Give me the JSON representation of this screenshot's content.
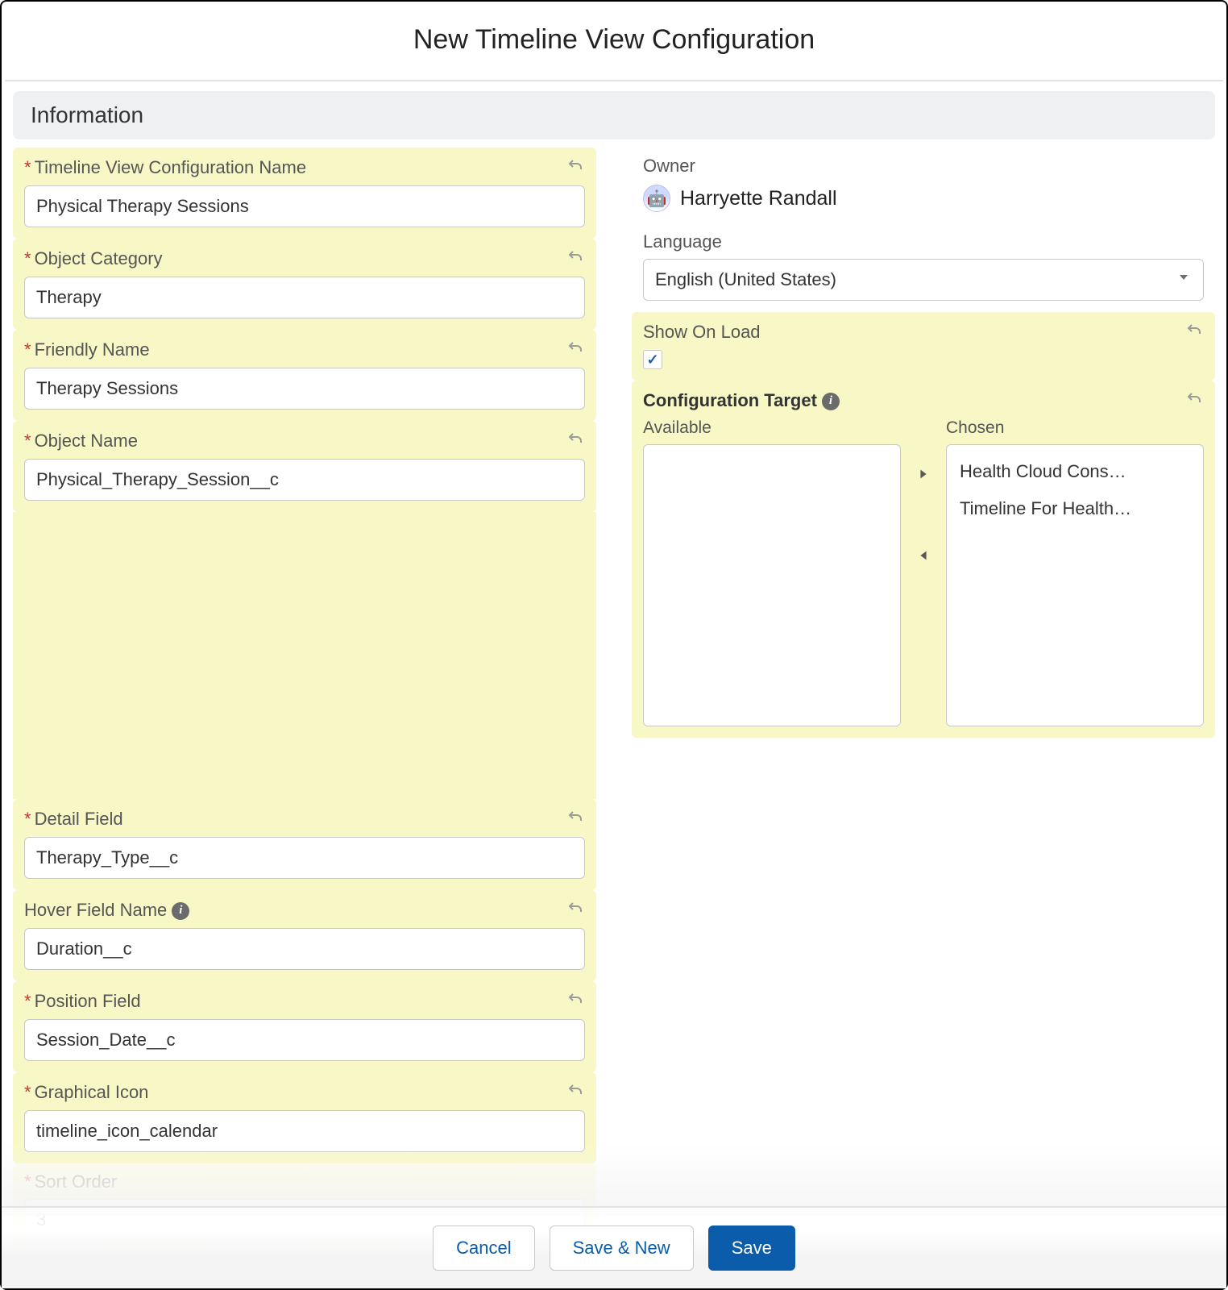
{
  "modal": {
    "title": "New Timeline View Configuration"
  },
  "section": {
    "information": "Information"
  },
  "left": {
    "config_name": {
      "label": "Timeline View Configuration Name",
      "value": "Physical Therapy Sessions"
    },
    "object_category": {
      "label": "Object Category",
      "value": "Therapy"
    },
    "friendly_name": {
      "label": "Friendly Name",
      "value": "Therapy Sessions"
    },
    "object_name": {
      "label": "Object Name",
      "value": "Physical_Therapy_Session__c"
    },
    "detail_field": {
      "label": "Detail Field",
      "value": "Therapy_Type__c"
    },
    "hover_field": {
      "label": "Hover Field Name",
      "value": "Duration__c"
    },
    "position_field": {
      "label": "Position Field",
      "value": "Session_Date__c"
    },
    "graphical_icon": {
      "label": "Graphical Icon",
      "value": "timeline_icon_calendar"
    },
    "sort_order": {
      "label": "Sort Order",
      "value": "3"
    }
  },
  "right": {
    "owner": {
      "label": "Owner",
      "value": "Harryette Randall"
    },
    "language": {
      "label": "Language",
      "value": "English (United States)"
    },
    "show_on_load": {
      "label": "Show On Load",
      "checked": true
    },
    "config_target": {
      "label": "Configuration Target",
      "available_label": "Available",
      "chosen_label": "Chosen",
      "available": [],
      "chosen": [
        "Health Cloud Cons…",
        "Timeline For Health…"
      ]
    }
  },
  "footer": {
    "cancel": "Cancel",
    "save_new": "Save & New",
    "save": "Save"
  }
}
